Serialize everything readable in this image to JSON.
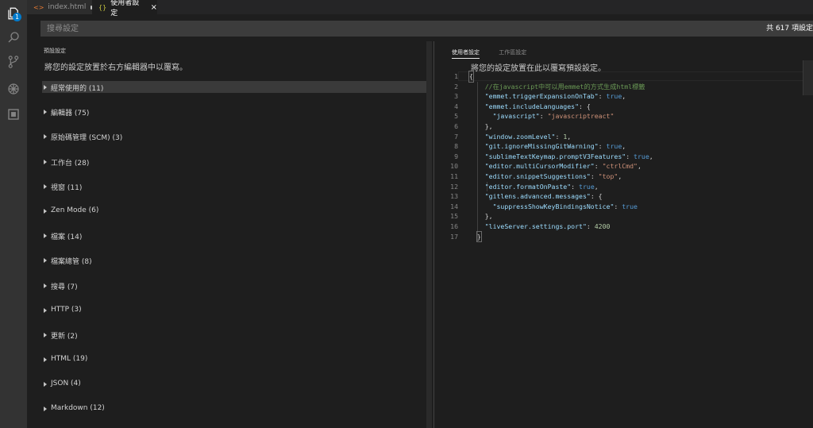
{
  "activity_bar": {
    "items": [
      {
        "icon": "files-icon",
        "badge": "1"
      },
      {
        "icon": "search-icon"
      },
      {
        "icon": "source-control-icon"
      },
      {
        "icon": "debug-icon"
      },
      {
        "icon": "extensions-icon"
      }
    ]
  },
  "tabs": [
    {
      "label": "index.html",
      "icon": "<>",
      "dirty": true
    },
    {
      "label": "使用者設定",
      "icon": "{}",
      "close": "×"
    }
  ],
  "search": {
    "placeholder": "搜尋設定",
    "count": "共 617 項設定"
  },
  "defaults": {
    "header": "預設設定",
    "description": "將您的設定放置於右方編輯器中以覆寫。",
    "categories": [
      "經常使用的 (11)",
      "編輯器 (75)",
      "原始碼管理 (SCM) (3)",
      "工作台 (28)",
      "視窗 (11)",
      "Zen Mode (6)",
      "檔案 (14)",
      "檔案總管 (8)",
      "搜尋 (7)",
      "HTTP (3)",
      "更新 (2)",
      "HTML (19)",
      "JSON (4)",
      "Markdown (12)"
    ]
  },
  "user_settings": {
    "tabs": [
      "使用者設定",
      "工作區設定"
    ],
    "description": "將您的設定放置在此以覆寫預設設定。",
    "line_numbers": [
      "1",
      "2",
      "3",
      "4",
      "5",
      "6",
      "7",
      "8",
      "9",
      "10",
      "11",
      "12",
      "13",
      "14",
      "15",
      "16",
      "17"
    ],
    "code": {
      "l1": "{",
      "l2": "//在javascript中可以用emmet的方式生成html標籤",
      "l3_key": "\"emmet.triggerExpansionOnTab\"",
      "l3_val": "true",
      "l4_key": "\"emmet.includeLanguages\"",
      "l4_val": "{",
      "l5_key": "\"javascript\"",
      "l5_val": "\"javascriptreact\"",
      "l6": "},",
      "l7_key": "\"window.zoomLevel\"",
      "l7_val": "1",
      "l8_key": "\"git.ignoreMissingGitWarning\"",
      "l8_val": "true",
      "l9_key": "\"sublimeTextKeymap.promptV3Features\"",
      "l9_val": "true",
      "l10_key": "\"editor.multiCursorModifier\"",
      "l10_val": "\"ctrlCmd\"",
      "l11_key": "\"editor.snippetSuggestions\"",
      "l11_val": "\"top\"",
      "l12_key": "\"editor.formatOnPaste\"",
      "l12_val": "true",
      "l13_key": "\"gitlens.advanced.messages\"",
      "l13_val": "{",
      "l14_key": "\"suppressShowKeyBindingsNotice\"",
      "l14_val": "true",
      "l15": "},",
      "l16_key": "\"liveServer.settings.port\"",
      "l16_val": "4200",
      "l17": "}"
    }
  },
  "colors": {
    "activity_bar": "#333333",
    "editor_bg": "#1e1e1e",
    "badge": "#007acc",
    "key": "#9cdcfe",
    "string": "#ce9178",
    "keyword": "#569cd6",
    "comment": "#6a9955"
  }
}
